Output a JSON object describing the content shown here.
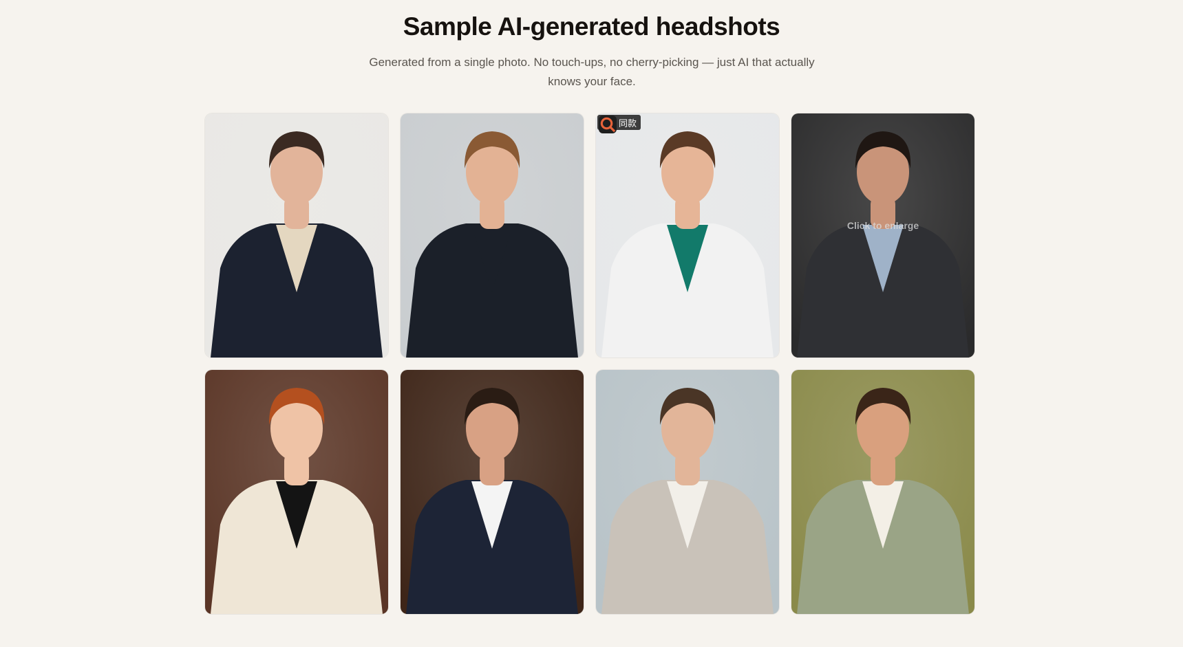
{
  "header": {
    "title": "Sample AI-generated headshots",
    "subtitle": "Generated from a single photo. No touch-ups, no cherry-picking — just AI that actually knows your face."
  },
  "gallery": {
    "hover_hint": "Click to enlarge",
    "badge_label": "同款",
    "badge_icon": "search-scan-icon",
    "items": [
      {
        "name": "woman-navy-blazer",
        "bg": "#e9e8e5",
        "suit": "#1c2230",
        "shirt": "#e4d7c0",
        "hair": "#3b2a22",
        "skin": "#e2b49a"
      },
      {
        "name": "man-dark-sweater-office",
        "bg": "#c9cdd0",
        "suit": "#1b2029",
        "shirt": "#1b2029",
        "hair": "#8a5a34",
        "skin": "#e3b294"
      },
      {
        "name": "woman-doctor-white-coat",
        "bg": "#e6e8ea",
        "suit": "#f2f2f2",
        "shirt": "#127a6a",
        "hair": "#5a3a26",
        "skin": "#e6b597"
      },
      {
        "name": "man-grey-suit-dark-bg",
        "bg": "#2a2a2b",
        "suit": "#2f3034",
        "shirt": "#9fb2c8",
        "hair": "#1f1713",
        "skin": "#c99479"
      },
      {
        "name": "woman-red-hair-brick-cafe",
        "bg": "#5a3526",
        "suit": "#efe6d6",
        "shirt": "#141414",
        "hair": "#b4501f",
        "skin": "#efc3a6"
      },
      {
        "name": "man-navy-suit-library",
        "bg": "#3e2518",
        "suit": "#1d2436",
        "shirt": "#f4f4f4",
        "hair": "#2a1c14",
        "skin": "#d8a184"
      },
      {
        "name": "woman-beige-blazer-window",
        "bg": "#b8c3c8",
        "suit": "#c9c2b9",
        "shirt": "#f2efe9",
        "hair": "#4a3526",
        "skin": "#e2b599"
      },
      {
        "name": "man-green-blazer-outdoor",
        "bg": "#8a8a4a",
        "suit": "#9aa486",
        "shirt": "#f3efe6",
        "hair": "#3a2518",
        "skin": "#d9a07e"
      }
    ]
  }
}
